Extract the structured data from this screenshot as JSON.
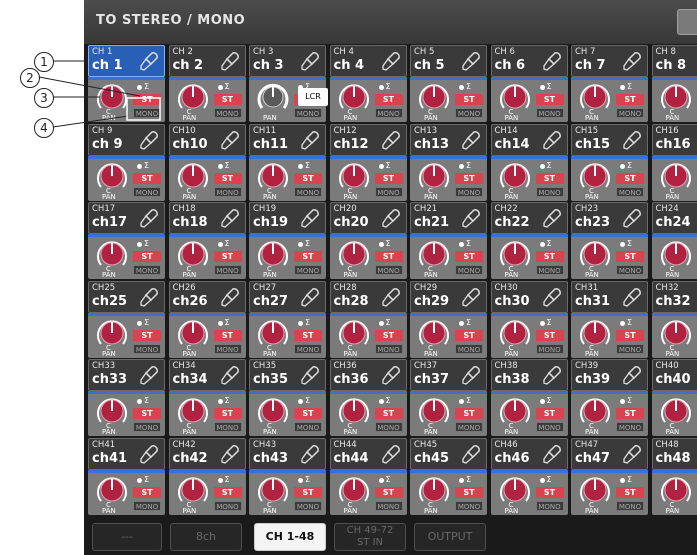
{
  "window": {
    "title": "TO STEREO / MONO"
  },
  "annotations": [
    "1",
    "2",
    "3",
    "4"
  ],
  "channel_common": {
    "st_label": "ST",
    "mono_label": "MONO",
    "pan_label": "PAN",
    "pan_value": "C",
    "sigma": "Σ"
  },
  "lcr_label": "LCR",
  "channels": [
    {
      "num": "CH 1",
      "name": "ch 1"
    },
    {
      "num": "CH 2",
      "name": "ch 2"
    },
    {
      "num": "CH 3",
      "name": "ch 3"
    },
    {
      "num": "CH 4",
      "name": "ch 4"
    },
    {
      "num": "CH 5",
      "name": "ch 5"
    },
    {
      "num": "CH 6",
      "name": "ch 6"
    },
    {
      "num": "CH 7",
      "name": "ch 7"
    },
    {
      "num": "CH 8",
      "name": "ch 8"
    },
    {
      "num": "CH 9",
      "name": "ch 9"
    },
    {
      "num": "CH10",
      "name": "ch10"
    },
    {
      "num": "CH11",
      "name": "ch11"
    },
    {
      "num": "CH12",
      "name": "ch12"
    },
    {
      "num": "CH13",
      "name": "ch13"
    },
    {
      "num": "CH14",
      "name": "ch14"
    },
    {
      "num": "CH15",
      "name": "ch15"
    },
    {
      "num": "CH16",
      "name": "ch16"
    },
    {
      "num": "CH17",
      "name": "ch17"
    },
    {
      "num": "CH18",
      "name": "ch18"
    },
    {
      "num": "CH19",
      "name": "ch19"
    },
    {
      "num": "CH20",
      "name": "ch20"
    },
    {
      "num": "CH21",
      "name": "ch21"
    },
    {
      "num": "CH22",
      "name": "ch22"
    },
    {
      "num": "CH23",
      "name": "ch23"
    },
    {
      "num": "CH24",
      "name": "ch24"
    },
    {
      "num": "CH25",
      "name": "ch25"
    },
    {
      "num": "CH26",
      "name": "ch26"
    },
    {
      "num": "CH27",
      "name": "ch27"
    },
    {
      "num": "CH28",
      "name": "ch28"
    },
    {
      "num": "CH29",
      "name": "ch29"
    },
    {
      "num": "CH30",
      "name": "ch30"
    },
    {
      "num": "CH31",
      "name": "ch31"
    },
    {
      "num": "CH32",
      "name": "ch32"
    },
    {
      "num": "CH33",
      "name": "ch33"
    },
    {
      "num": "CH34",
      "name": "ch34"
    },
    {
      "num": "CH35",
      "name": "ch35"
    },
    {
      "num": "CH36",
      "name": "ch36"
    },
    {
      "num": "CH37",
      "name": "ch37"
    },
    {
      "num": "CH38",
      "name": "ch38"
    },
    {
      "num": "CH39",
      "name": "ch39"
    },
    {
      "num": "CH40",
      "name": "ch40"
    },
    {
      "num": "CH41",
      "name": "ch41"
    },
    {
      "num": "CH42",
      "name": "ch42"
    },
    {
      "num": "CH43",
      "name": "ch43"
    },
    {
      "num": "CH44",
      "name": "ch44"
    },
    {
      "num": "CH45",
      "name": "ch45"
    },
    {
      "num": "CH46",
      "name": "ch46"
    },
    {
      "num": "CH47",
      "name": "ch47"
    },
    {
      "num": "CH48",
      "name": "ch48"
    }
  ],
  "selected_channel": 0,
  "lcr_channel": 2,
  "colors": {
    "accent_blue": "#2a5fb8",
    "st_red": "#d9424f",
    "knob_red": "#b02240"
  },
  "bottom_tabs": [
    {
      "label": "---",
      "active": false
    },
    {
      "label": "8ch",
      "active": false
    },
    {
      "label": "CH 1-48",
      "active": true
    },
    {
      "label": "CH 49-72",
      "label2": "ST IN",
      "active": false
    },
    {
      "label": "OUTPUT",
      "active": false
    }
  ]
}
